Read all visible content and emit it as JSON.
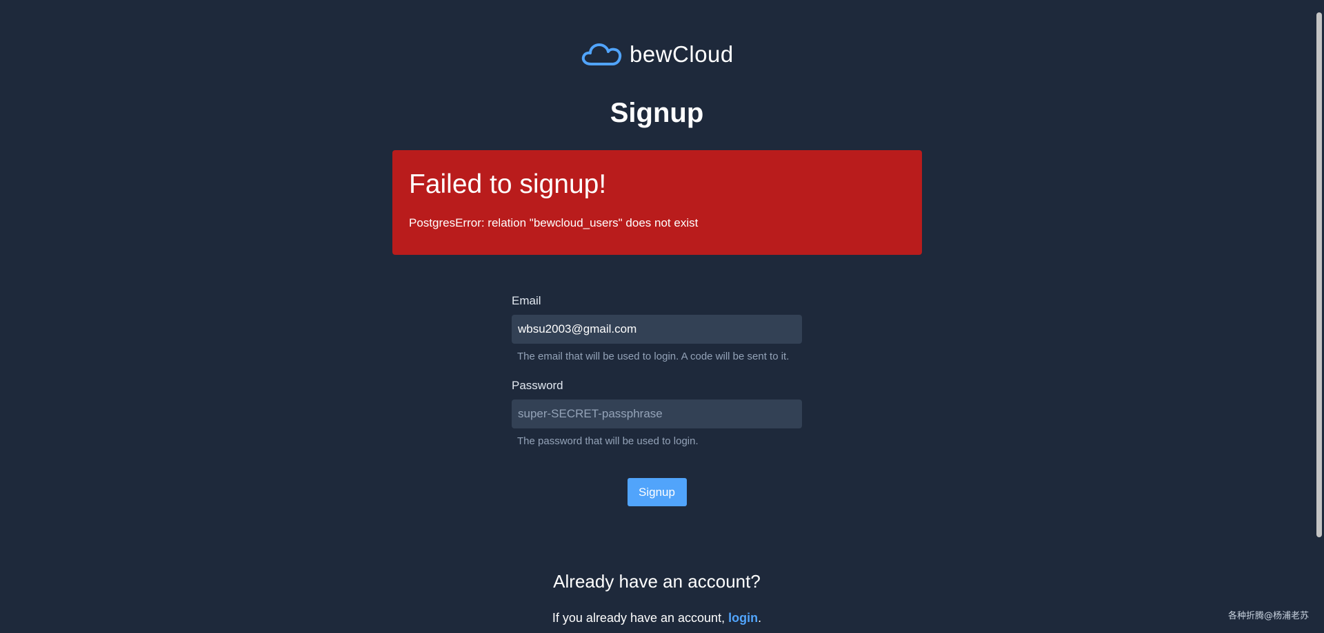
{
  "brand": {
    "name": "bewCloud",
    "icon": "cloud-icon",
    "icon_color": "#51a4fb"
  },
  "page": {
    "title": "Signup"
  },
  "alert": {
    "title": "Failed to signup!",
    "message": "PostgresError: relation \"bewcloud_users\" does not exist",
    "color": "#b91c1c"
  },
  "form": {
    "email": {
      "label": "Email",
      "value": "wbsu2003@gmail.com",
      "help": "The email that will be used to login. A code will be sent to it."
    },
    "password": {
      "label": "Password",
      "placeholder": "super-SECRET-passphrase",
      "value": "",
      "help": "The password that will be used to login."
    },
    "submit_label": "Signup"
  },
  "account": {
    "heading": "Already have an account?",
    "prefix": "If you already have an account, ",
    "link_label": "login",
    "suffix": "."
  },
  "watermark": "各种折腾@杨浦老苏",
  "colors": {
    "background": "#1e293b",
    "accent": "#51a4fb",
    "input_bg": "#334155"
  }
}
